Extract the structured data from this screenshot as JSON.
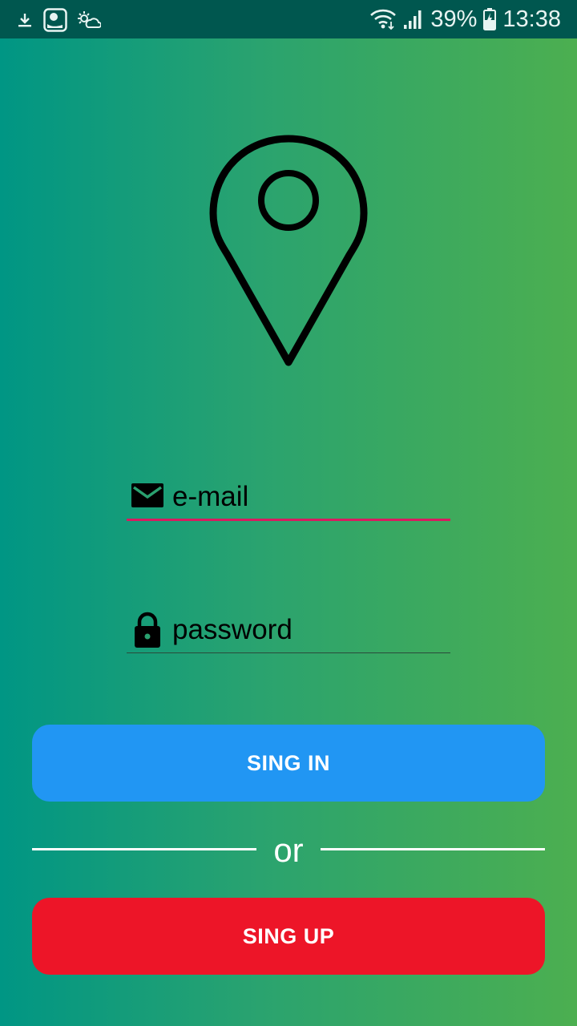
{
  "status_bar": {
    "battery_percent": "39%",
    "time": "13:38",
    "icons": [
      "download-icon",
      "app-notification-icon",
      "weather-icon",
      "wifi-icon",
      "signal-icon",
      "battery-charging-icon"
    ]
  },
  "logo": {
    "icon": "location-pin-icon"
  },
  "form": {
    "email": {
      "placeholder": "e-mail",
      "value": "",
      "icon": "mail-icon"
    },
    "password": {
      "placeholder": "password",
      "value": "",
      "icon": "lock-icon"
    }
  },
  "buttons": {
    "sign_in": "SING IN",
    "sign_up": "SING UP"
  },
  "divider": {
    "text": "or"
  },
  "colors": {
    "gradient_start": "#009684",
    "gradient_end": "#4caf50",
    "status_bar": "#00574f",
    "email_underline_focus": "#d81b60",
    "sign_in_button": "#2196f3",
    "sign_up_button": "#ed1528"
  }
}
